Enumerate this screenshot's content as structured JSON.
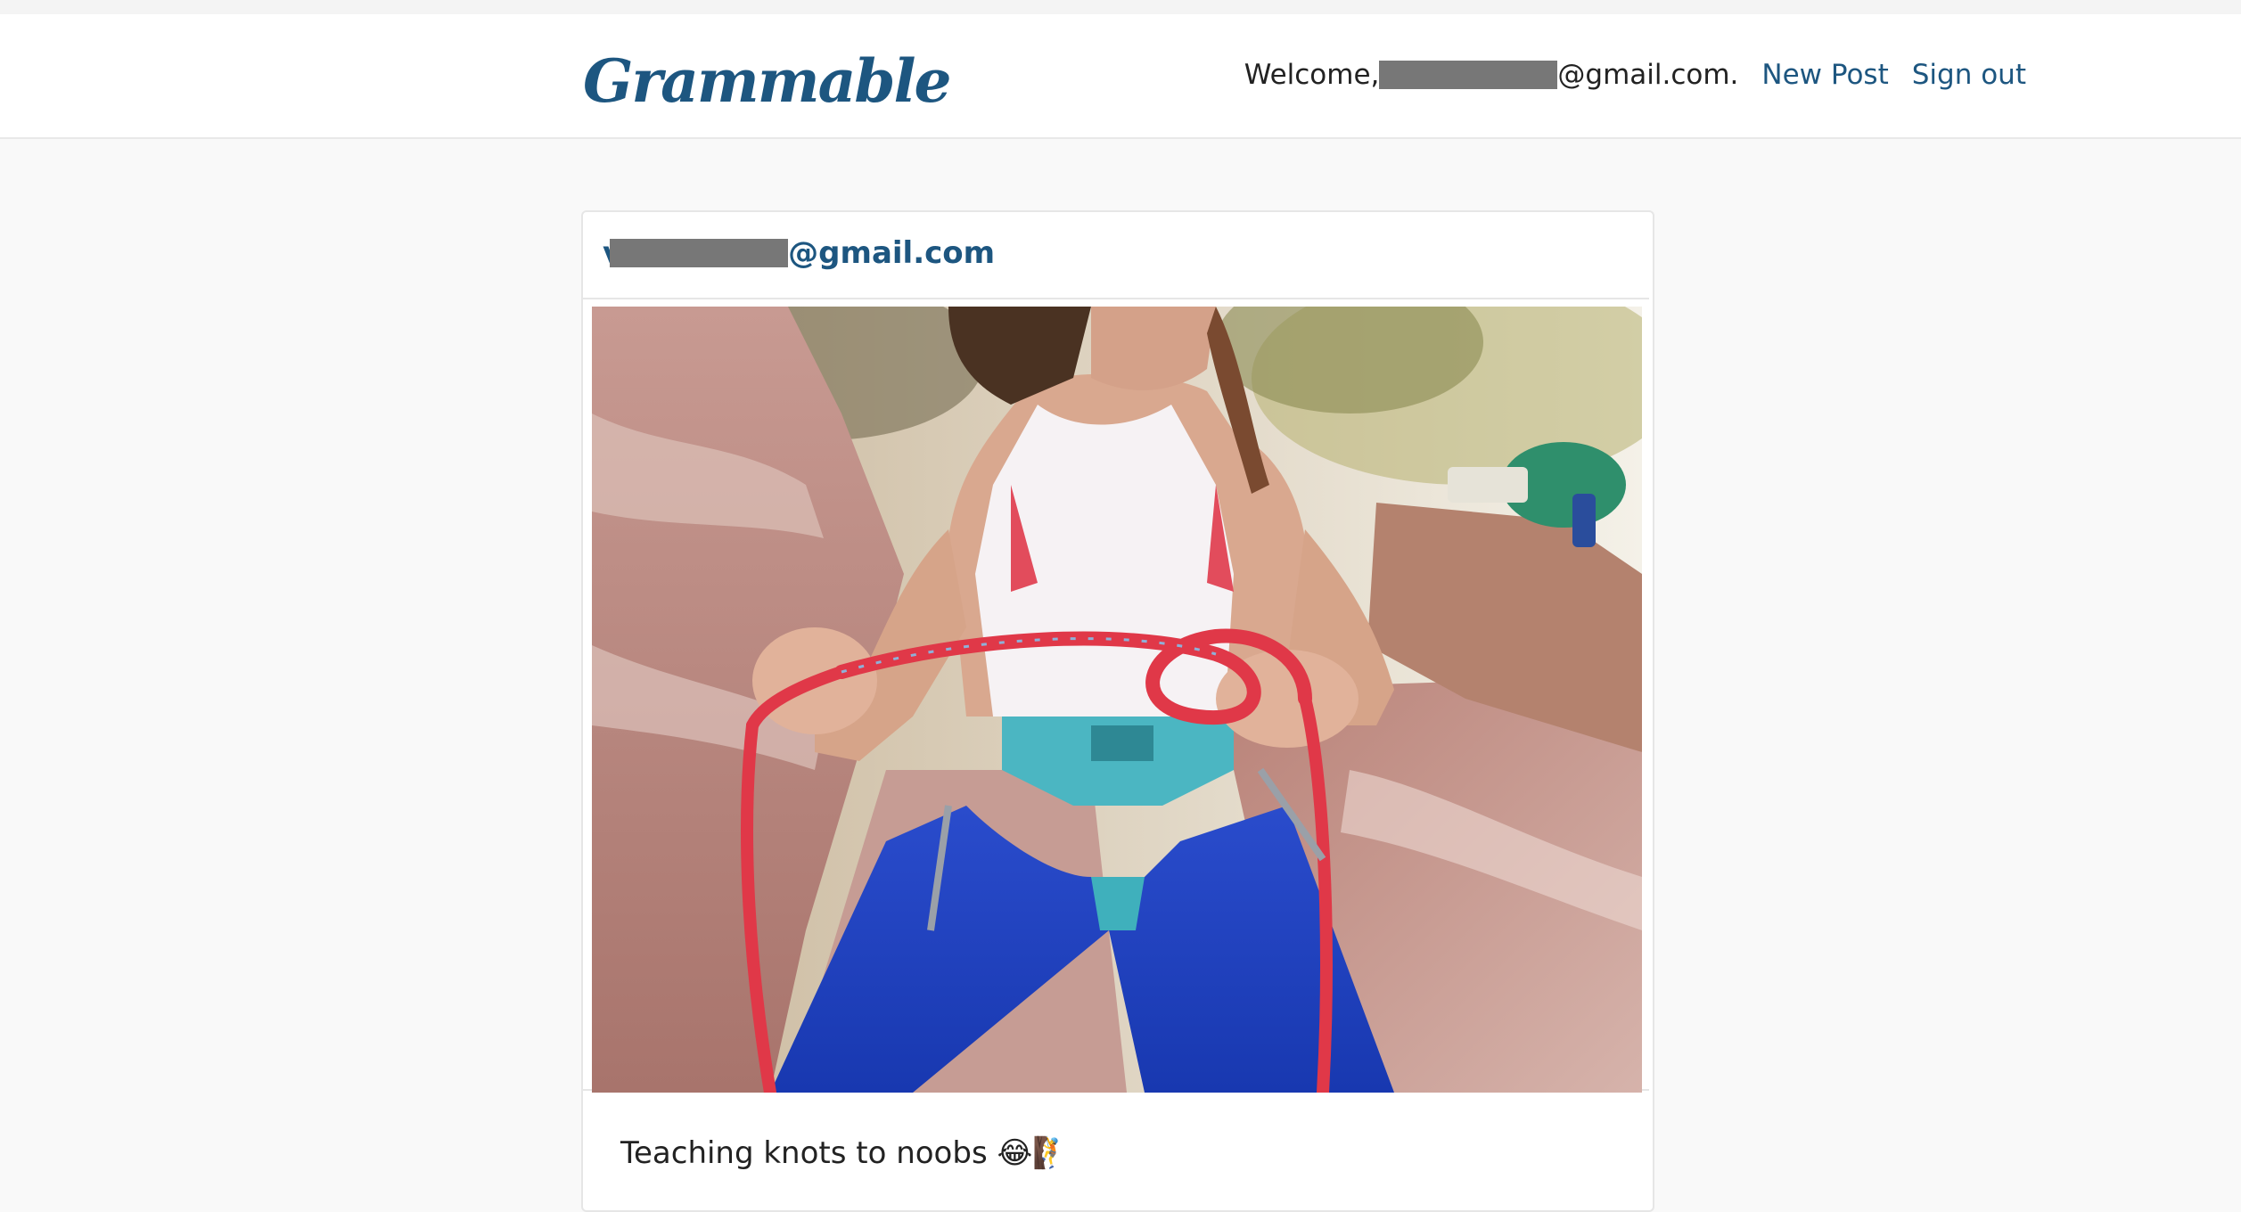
{
  "navbar": {
    "logo": "Grammable",
    "welcome_prefix": "Welcome,",
    "welcome_suffix": "@gmail.com.",
    "new_post_label": "New Post",
    "sign_out_label": "Sign out"
  },
  "post": {
    "author_prefix": "v",
    "author_suffix": "@gmail.com",
    "image_alt": "Climber tying a figure-eight knot in a red rope while sitting on red sandstone rocks",
    "caption": "Teaching knots to noobs 😂🧗"
  },
  "colors": {
    "brand": "#1d5680",
    "page_bg": "#f9f9f9",
    "card_bg": "#ffffff",
    "redaction": "#777777"
  }
}
